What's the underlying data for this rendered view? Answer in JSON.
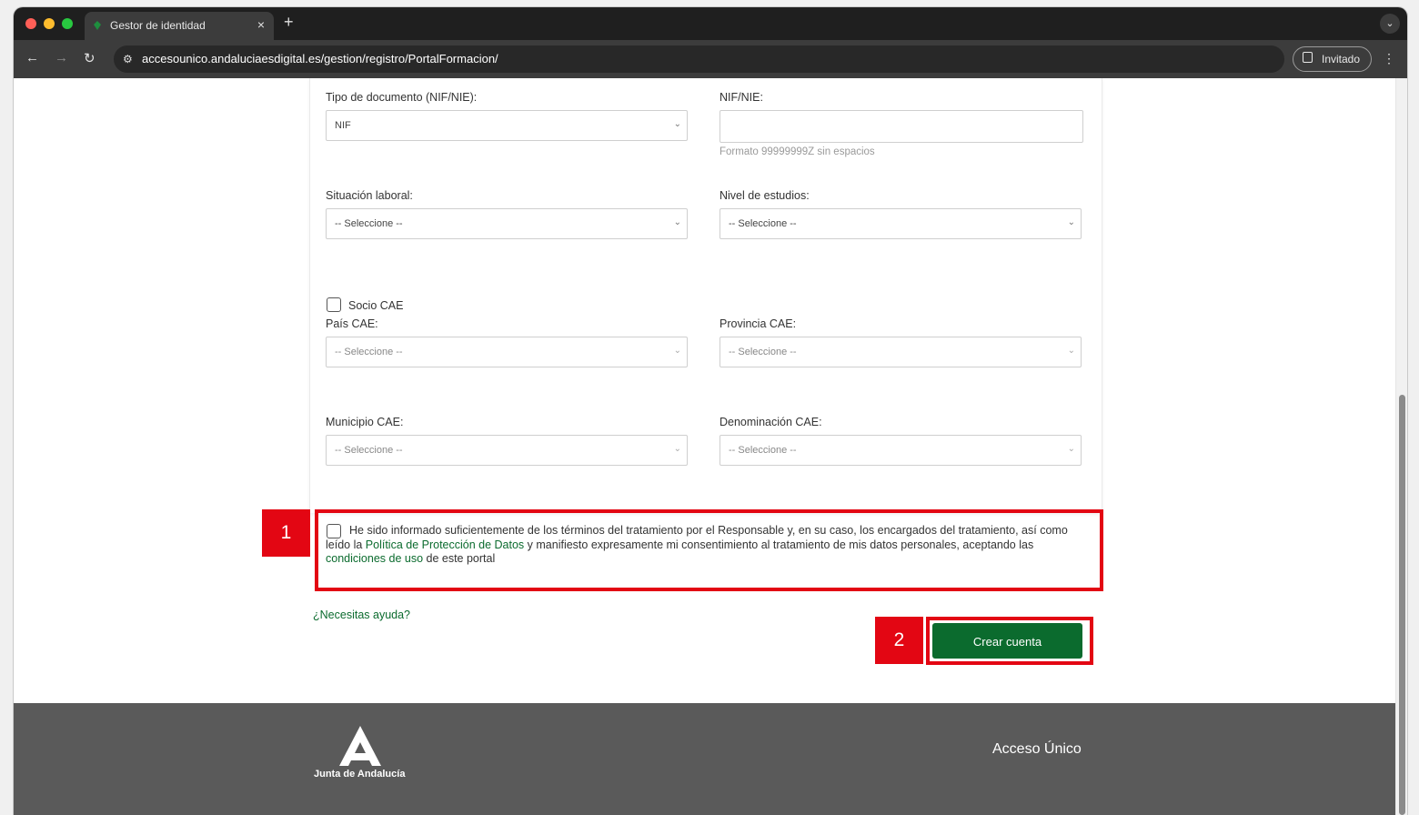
{
  "browser": {
    "tab_title": "Gestor de identidad",
    "tab_close": "×",
    "new_tab": "+",
    "url": "accesounico.andaluciaesdigital.es/gestion/registro/PortalFormacion/",
    "profile_label": "Invitado",
    "icons": [
      "back-icon",
      "forward-icon",
      "reload-icon",
      "site-settings-icon",
      "profile-icon",
      "kebab-menu-icon",
      "tab-search-icon"
    ]
  },
  "form": {
    "doc_type_label": "Tipo de documento (NIF/NIE):",
    "doc_type_value": "NIF",
    "nif_label": "NIF/NIE:",
    "nif_value": "",
    "nif_hint": "Formato 99999999Z sin espacios",
    "situacion_label": "Situación laboral:",
    "situacion_value": "-- Seleccione --",
    "nivel_label": "Nivel de estudios:",
    "nivel_value": "-- Seleccione --",
    "socio_label": "Socio CAE",
    "pais_label": "País CAE:",
    "pais_value": "-- Seleccione --",
    "provincia_label": "Provincia CAE:",
    "provincia_value": "-- Seleccione --",
    "municipio_label": "Municipio CAE:",
    "municipio_value": "-- Seleccione --",
    "denominacion_label": "Denominación CAE:",
    "denominacion_value": "-- Seleccione --"
  },
  "consent": {
    "text_1": "He sido informado suficientemente de los términos del tratamiento por el Responsable y, en su caso, los encargados del tratamiento, así como leído la ",
    "link_policy": "Política de Protección de Datos",
    "text_2": " y manifiesto expresamente mi consentimiento al tratamiento de mis datos personales, aceptando las ",
    "link_terms": "condiciones de uso",
    "text_3": " de este portal"
  },
  "help_link": "¿Necesitas ayuda?",
  "submit_label": "Crear cuenta",
  "annotations": {
    "marker_1": "1",
    "marker_2": "2"
  },
  "footer": {
    "logo_text": "Junta de Andalucía",
    "brand": "Acceso Único"
  },
  "colors": {
    "accent_green": "#0b6b2e",
    "annotation_red": "#e30613",
    "footer_bg": "#5a5a5a"
  }
}
